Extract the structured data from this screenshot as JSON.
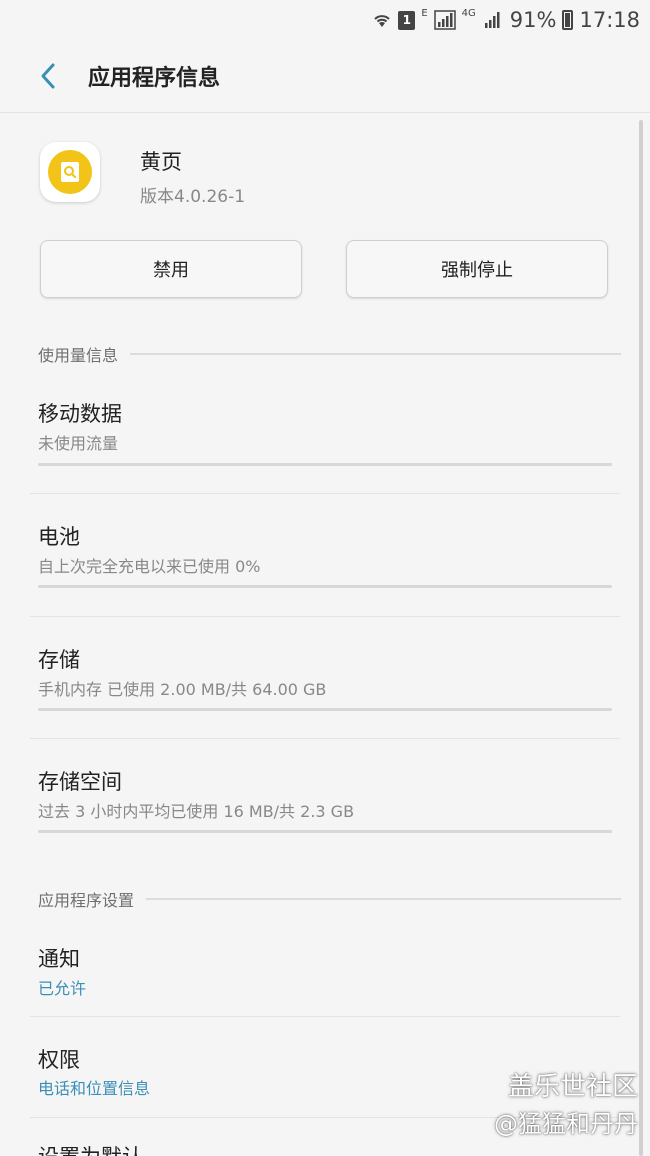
{
  "status_bar": {
    "sim_slot": "1",
    "network_e": "E",
    "network_4g": "4G",
    "battery": "91%",
    "time": "17:18"
  },
  "appbar": {
    "title": "应用程序信息",
    "back_icon": "chevron-left-icon",
    "accent": "#3a8fb7"
  },
  "app": {
    "name": "黄页",
    "version": "版本4.0.26-1",
    "icon": "yellow-pages-icon",
    "icon_color": "#f2c417"
  },
  "buttons": {
    "disable": "禁用",
    "force_stop": "强制停止"
  },
  "usage_section": {
    "header": "使用量信息",
    "items": [
      {
        "title": "移动数据",
        "subtitle": "未使用流量"
      },
      {
        "title": "电池",
        "subtitle": "自上次完全充电以来已使用 0%"
      },
      {
        "title": "存储",
        "subtitle": "手机内存 已使用 2.00 MB/共 64.00 GB"
      },
      {
        "title": "存储空间",
        "subtitle": "过去 3 小时内平均已使用 16 MB/共 2.3 GB"
      }
    ]
  },
  "settings_section": {
    "header": "应用程序设置",
    "items": [
      {
        "title": "通知",
        "subtitle": "已允许"
      },
      {
        "title": "权限",
        "subtitle": "电话和位置信息"
      },
      {
        "title": "设置为默认"
      }
    ]
  },
  "watermark": {
    "line1": "盖乐世社区",
    "line2": "@猛猛和丹丹"
  }
}
